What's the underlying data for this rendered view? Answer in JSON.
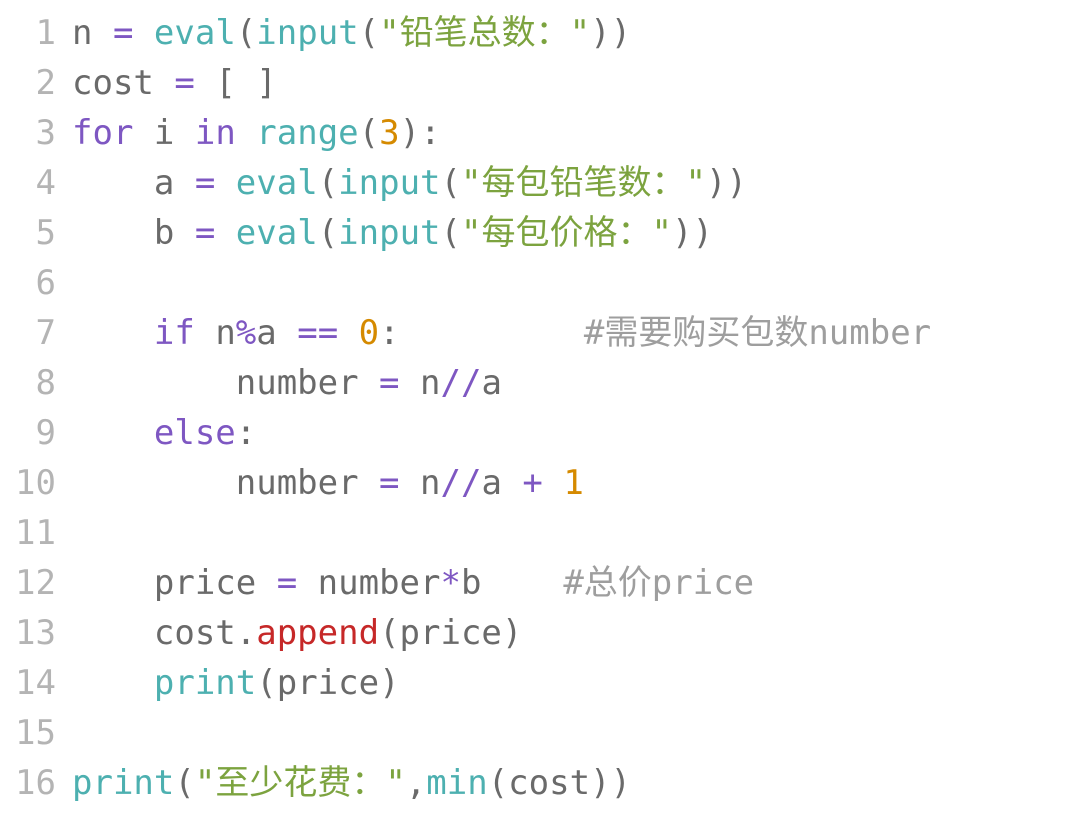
{
  "code": {
    "lines": [
      {
        "num": "1",
        "tokens": [
          {
            "c": "tok-plain",
            "t": "n "
          },
          {
            "c": "tok-keyword",
            "t": "="
          },
          {
            "c": "tok-plain",
            "t": " "
          },
          {
            "c": "tok-builtin",
            "t": "eval"
          },
          {
            "c": "tok-plain",
            "t": "("
          },
          {
            "c": "tok-builtin",
            "t": "input"
          },
          {
            "c": "tok-plain",
            "t": "("
          },
          {
            "c": "tok-string",
            "t": "\"铅笔总数：\""
          },
          {
            "c": "tok-plain",
            "t": "))"
          }
        ]
      },
      {
        "num": "2",
        "tokens": [
          {
            "c": "tok-plain",
            "t": "cost "
          },
          {
            "c": "tok-keyword",
            "t": "="
          },
          {
            "c": "tok-plain",
            "t": " [ ]"
          }
        ]
      },
      {
        "num": "3",
        "tokens": [
          {
            "c": "tok-keyword",
            "t": "for"
          },
          {
            "c": "tok-plain",
            "t": " i "
          },
          {
            "c": "tok-keyword",
            "t": "in"
          },
          {
            "c": "tok-plain",
            "t": " "
          },
          {
            "c": "tok-builtin",
            "t": "range"
          },
          {
            "c": "tok-plain",
            "t": "("
          },
          {
            "c": "tok-number",
            "t": "3"
          },
          {
            "c": "tok-plain",
            "t": "):"
          }
        ]
      },
      {
        "num": "4",
        "tokens": [
          {
            "c": "tok-plain",
            "t": "    a "
          },
          {
            "c": "tok-keyword",
            "t": "="
          },
          {
            "c": "tok-plain",
            "t": " "
          },
          {
            "c": "tok-builtin",
            "t": "eval"
          },
          {
            "c": "tok-plain",
            "t": "("
          },
          {
            "c": "tok-builtin",
            "t": "input"
          },
          {
            "c": "tok-plain",
            "t": "("
          },
          {
            "c": "tok-string",
            "t": "\"每包铅笔数：\""
          },
          {
            "c": "tok-plain",
            "t": "))"
          }
        ]
      },
      {
        "num": "5",
        "tokens": [
          {
            "c": "tok-plain",
            "t": "    b "
          },
          {
            "c": "tok-keyword",
            "t": "="
          },
          {
            "c": "tok-plain",
            "t": " "
          },
          {
            "c": "tok-builtin",
            "t": "eval"
          },
          {
            "c": "tok-plain",
            "t": "("
          },
          {
            "c": "tok-builtin",
            "t": "input"
          },
          {
            "c": "tok-plain",
            "t": "("
          },
          {
            "c": "tok-string",
            "t": "\"每包价格：\""
          },
          {
            "c": "tok-plain",
            "t": "))"
          }
        ]
      },
      {
        "num": "6",
        "tokens": []
      },
      {
        "num": "7",
        "tokens": [
          {
            "c": "tok-plain",
            "t": "    "
          },
          {
            "c": "tok-keyword",
            "t": "if"
          },
          {
            "c": "tok-plain",
            "t": " n"
          },
          {
            "c": "tok-keyword",
            "t": "%"
          },
          {
            "c": "tok-plain",
            "t": "a "
          },
          {
            "c": "tok-keyword",
            "t": "=="
          },
          {
            "c": "tok-plain",
            "t": " "
          },
          {
            "c": "tok-number",
            "t": "0"
          },
          {
            "c": "tok-plain",
            "t": ":         "
          },
          {
            "c": "tok-comment",
            "t": "#需要购买包数number"
          }
        ]
      },
      {
        "num": "8",
        "tokens": [
          {
            "c": "tok-plain",
            "t": "        number "
          },
          {
            "c": "tok-keyword",
            "t": "="
          },
          {
            "c": "tok-plain",
            "t": " n"
          },
          {
            "c": "tok-keyword",
            "t": "//"
          },
          {
            "c": "tok-plain",
            "t": "a"
          }
        ]
      },
      {
        "num": "9",
        "tokens": [
          {
            "c": "tok-plain",
            "t": "    "
          },
          {
            "c": "tok-keyword",
            "t": "else"
          },
          {
            "c": "tok-plain",
            "t": ":"
          }
        ]
      },
      {
        "num": "10",
        "tokens": [
          {
            "c": "tok-plain",
            "t": "        number "
          },
          {
            "c": "tok-keyword",
            "t": "="
          },
          {
            "c": "tok-plain",
            "t": " n"
          },
          {
            "c": "tok-keyword",
            "t": "//"
          },
          {
            "c": "tok-plain",
            "t": "a "
          },
          {
            "c": "tok-keyword",
            "t": "+"
          },
          {
            "c": "tok-plain",
            "t": " "
          },
          {
            "c": "tok-number",
            "t": "1"
          }
        ]
      },
      {
        "num": "11",
        "tokens": []
      },
      {
        "num": "12",
        "tokens": [
          {
            "c": "tok-plain",
            "t": "    price "
          },
          {
            "c": "tok-keyword",
            "t": "="
          },
          {
            "c": "tok-plain",
            "t": " number"
          },
          {
            "c": "tok-keyword",
            "t": "*"
          },
          {
            "c": "tok-plain",
            "t": "b    "
          },
          {
            "c": "tok-comment",
            "t": "#总价price"
          }
        ]
      },
      {
        "num": "13",
        "tokens": [
          {
            "c": "tok-plain",
            "t": "    cost."
          },
          {
            "c": "tok-builtin2",
            "t": "append"
          },
          {
            "c": "tok-plain",
            "t": "(price)"
          }
        ]
      },
      {
        "num": "14",
        "tokens": [
          {
            "c": "tok-plain",
            "t": "    "
          },
          {
            "c": "tok-builtin",
            "t": "print"
          },
          {
            "c": "tok-plain",
            "t": "(price)"
          }
        ]
      },
      {
        "num": "15",
        "tokens": []
      },
      {
        "num": "16",
        "tokens": [
          {
            "c": "tok-builtin",
            "t": "print"
          },
          {
            "c": "tok-plain",
            "t": "("
          },
          {
            "c": "tok-string",
            "t": "\"至少花费：\""
          },
          {
            "c": "tok-plain",
            "t": ","
          },
          {
            "c": "tok-builtin",
            "t": "min"
          },
          {
            "c": "tok-plain",
            "t": "(cost))"
          }
        ]
      }
    ]
  }
}
